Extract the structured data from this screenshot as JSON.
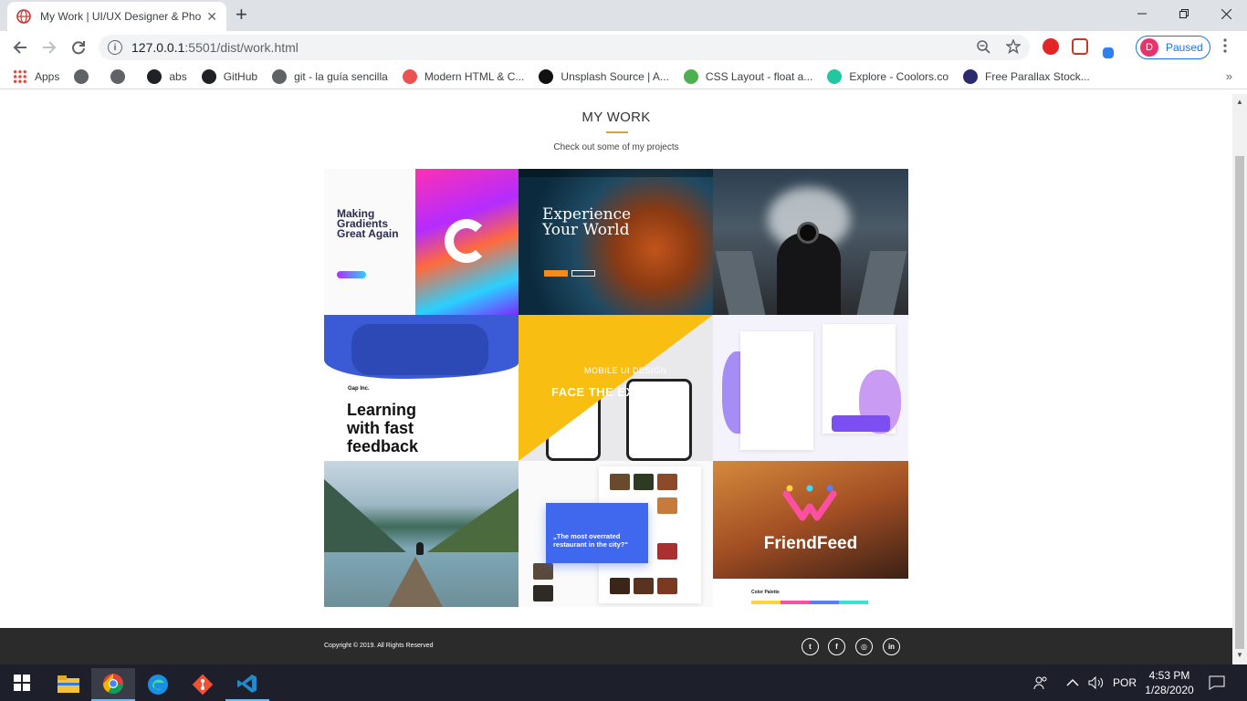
{
  "browser": {
    "tab_title": "My Work | UI/UX Designer & Pho",
    "tab_close": "✕",
    "new_tab": "+",
    "url_host": "127.0.0.1",
    "url_path": ":5501/dist/work.html",
    "profile_initial": "D",
    "profile_status": "Paused",
    "bookmarks": [
      {
        "label": "Apps",
        "icon": "apps-grid-icon",
        "color": "#e8453c"
      },
      {
        "label": "",
        "icon": "globe-icon",
        "color": "#5f6368"
      },
      {
        "label": "",
        "icon": "globe-icon",
        "color": "#5f6368"
      },
      {
        "label": "abs",
        "icon": "bookmark-s-icon",
        "color": "#202124"
      },
      {
        "label": "GitHub",
        "icon": "github-icon",
        "color": "#202124"
      },
      {
        "label": "git - la guía sencilla",
        "icon": "globe-icon",
        "color": "#5f6368"
      },
      {
        "label": "Modern HTML & C...",
        "icon": "udemy-icon",
        "color": "#ec5252"
      },
      {
        "label": "Unsplash Source | A...",
        "icon": "unsplash-icon",
        "color": "#111"
      },
      {
        "label": "CSS Layout - float a...",
        "icon": "w3-icon",
        "color": "#4caf50"
      },
      {
        "label": "Explore - Coolors.co",
        "icon": "coolors-icon",
        "color": "#1fc8a0"
      },
      {
        "label": "Free Parallax Stock...",
        "icon": "v-icon",
        "color": "#2c2a6e"
      }
    ]
  },
  "page": {
    "heading": "MY WORK",
    "subheading": "Check out some of my projects",
    "accent": "#d8a23a",
    "portfolio": [
      {
        "text": "Making Gradients Great Again"
      },
      {
        "text": "Experience Your World"
      },
      {
        "text": ""
      },
      {
        "text_company": "Gap Inc.",
        "text": "Learning with fast feedback"
      },
      {
        "text_small": "MOBILE UI DESIGN",
        "text": "FACE THE EXPE"
      },
      {
        "text": ""
      },
      {
        "text": ""
      },
      {
        "text": "„The most overrated restaurant in the city?\""
      },
      {
        "text": "FriendFeed",
        "text_small": "Color Palette"
      }
    ],
    "footer": {
      "copyright": "Copyright © 2019. All Rights Reserved",
      "social": [
        "twitter-icon",
        "facebook-icon",
        "instagram-icon",
        "linkedin-icon"
      ]
    }
  },
  "taskbar": {
    "language": "POR",
    "time": "4:53 PM",
    "date": "1/28/2020"
  }
}
